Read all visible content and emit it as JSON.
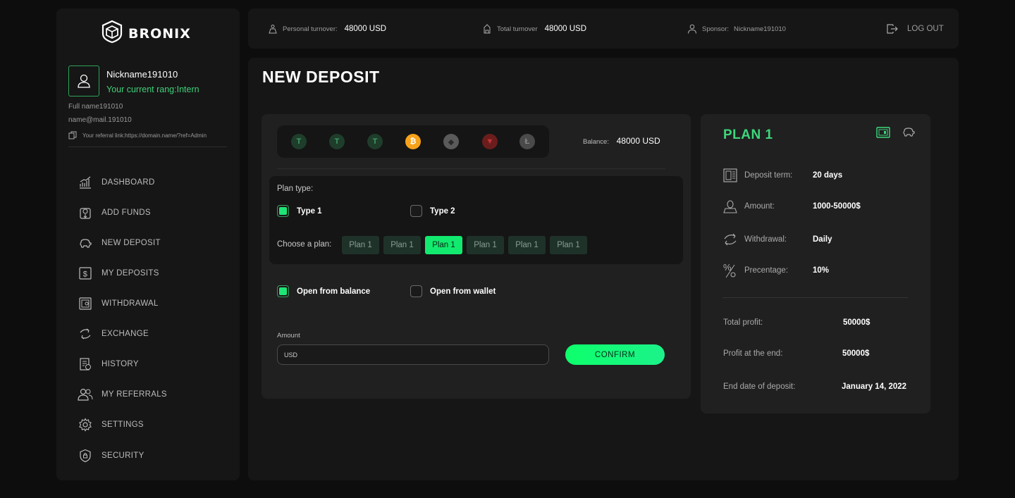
{
  "brand": {
    "name": "BRONIX"
  },
  "profile": {
    "nickname": "Nickname191010",
    "rang": "Your current rang:Intern",
    "full_name": "Full name191010",
    "email": "name@mail.191010",
    "referral": "Your referral link:https://domain.name/?ref=Admin"
  },
  "nav": [
    {
      "label": "DASHBOARD",
      "icon": "chart-icon"
    },
    {
      "label": "ADD FUNDS",
      "icon": "wallet-add-icon"
    },
    {
      "label": "NEW DEPOSIT",
      "icon": "piggy-bank-icon"
    },
    {
      "label": "MY DEPOSITS",
      "icon": "dollar-icon"
    },
    {
      "label": "WITHDRAWAL",
      "icon": "safe-icon"
    },
    {
      "label": "EXCHANGE",
      "icon": "exchange-icon"
    },
    {
      "label": "HISTORY",
      "icon": "history-icon"
    },
    {
      "label": "MY REFERRALS",
      "icon": "users-icon"
    },
    {
      "label": "SETTINGS",
      "icon": "gear-icon"
    },
    {
      "label": "SECURITY",
      "icon": "shield-icon"
    }
  ],
  "topbar": {
    "personal_label": "Personal turnover:",
    "personal_value": "48000 USD",
    "total_label": "Total turnover",
    "total_value": "48000 USD",
    "sponsor_label": "Sponsor:",
    "sponsor_value": "Nickname191010",
    "logout": "LOG OUT"
  },
  "page": {
    "title": "NEW DEPOSIT"
  },
  "deposit": {
    "coins": [
      {
        "symbol": "T",
        "icon": "tether-icon",
        "color": "#1f3d2b",
        "fg": "#3f9a66"
      },
      {
        "symbol": "T",
        "icon": "tether-trc-icon",
        "color": "#1f3d2b",
        "fg": "#3f9a66"
      },
      {
        "symbol": "T",
        "icon": "tether-erc-icon",
        "color": "#1f3d2b",
        "fg": "#3f9a66"
      },
      {
        "symbol": "₿",
        "icon": "bitcoin-icon",
        "color": "#f7a21b",
        "fg": "#ffffff"
      },
      {
        "symbol": "◆",
        "icon": "ethereum-icon",
        "color": "#5a5a5a",
        "fg": "#2a2a2a"
      },
      {
        "symbol": "▼",
        "icon": "tron-icon",
        "color": "#6b1d1d",
        "fg": "#c63434"
      },
      {
        "symbol": "Ł",
        "icon": "litecoin-icon",
        "color": "#4a4a4a",
        "fg": "#8a8a8a"
      }
    ],
    "balance_label": "Balance:",
    "balance_value": "48000 USD",
    "plan_type_label": "Plan type:",
    "type1": "Type 1",
    "type2": "Type 2",
    "choose_plan_label": "Choose a plan:",
    "plans": [
      "Plan 1",
      "Plan 1",
      "Plan 1",
      "Plan 1",
      "Plan 1",
      "Plan 1"
    ],
    "active_plan_index": 2,
    "open_balance": "Open from balance",
    "open_wallet": "Open from wallet",
    "amount_label": "Amount",
    "amount_placeholder": "USD",
    "confirm": "CONFIRM"
  },
  "plan_card": {
    "title": "PLAN 1",
    "rows": [
      {
        "label": "Deposit term:",
        "value": "20 days",
        "icon": "calendar-icon"
      },
      {
        "label": "Amount:",
        "value": "1000-50000$",
        "icon": "coins-hand-icon"
      },
      {
        "label": "Withdrawal:",
        "value": "Daily",
        "icon": "hand-money-icon"
      },
      {
        "label": "Precentage:",
        "value": "10%",
        "icon": "percent-icon"
      }
    ],
    "total_profit_label": "Total profit:",
    "total_profit_value": "50000$",
    "profit_end_label": "Profit at the end:",
    "profit_end_value": "50000$",
    "end_date_label": "End date of deposit:",
    "end_date_value": "January 14, 2022"
  },
  "colors": {
    "accent": "#12ea6f",
    "accent_text": "#3dd77c",
    "panel": "#161616",
    "card": "#202020"
  }
}
